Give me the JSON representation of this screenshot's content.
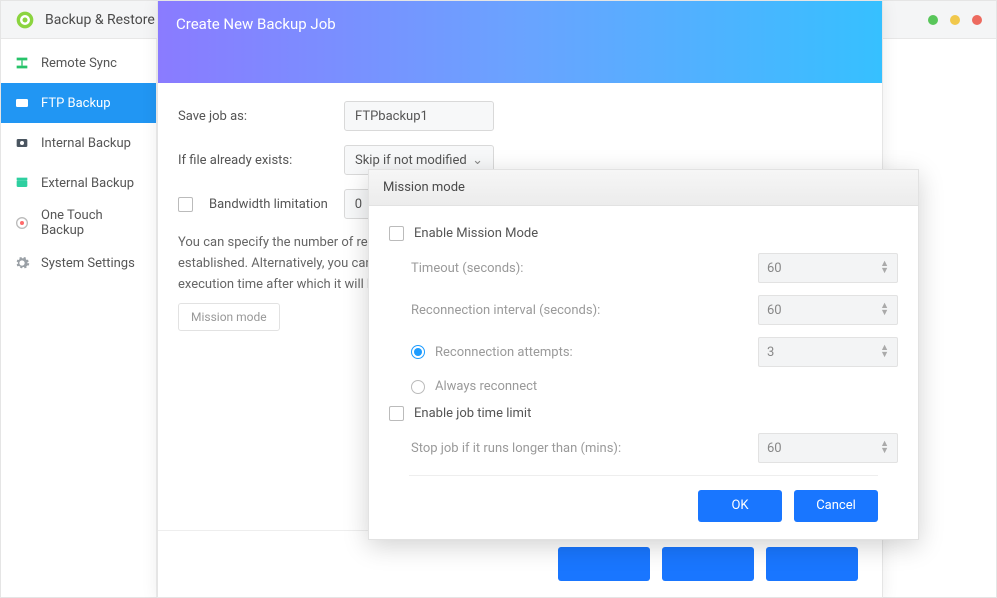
{
  "header": {
    "title": "Backup & Restore"
  },
  "sidebar": {
    "items": [
      {
        "label": "Remote Sync"
      },
      {
        "label": "FTP Backup"
      },
      {
        "label": "Internal Backup"
      },
      {
        "label": "External Backup"
      },
      {
        "label": "One Touch Backup"
      },
      {
        "label": "System Settings"
      }
    ]
  },
  "createJob": {
    "title": "Create New Backup Job",
    "saveAs": {
      "label": "Save job as:",
      "value": "FTPbackup1"
    },
    "ifExists": {
      "label": "If file already exists:",
      "value": "Skip if not modified"
    },
    "bandwidth": {
      "label": "Bandwidth limitation",
      "value": "0"
    },
    "description": "You can specify the number of reconnection attempts and time interval for cases when FTP connection cannot be established. Alternatively, you can enable Mission Mode to keep the job running until it completes or a maximum execution time after which it will be aborted.",
    "missionBtn": "Mission mode"
  },
  "missionPop": {
    "title": "Mission mode",
    "enableMission": "Enable Mission Mode",
    "timeout": {
      "label": "Timeout (seconds):",
      "value": "60"
    },
    "reconnInterval": {
      "label": "Reconnection interval (seconds):",
      "value": "60"
    },
    "reconnAttempts": {
      "label": "Reconnection attempts:",
      "value": "3"
    },
    "alwaysReconnect": "Always reconnect",
    "enableLimit": "Enable job time limit",
    "stopJob": {
      "label": "Stop job if it runs longer than (mins):",
      "value": "60"
    },
    "ok": "OK",
    "cancel": "Cancel"
  }
}
